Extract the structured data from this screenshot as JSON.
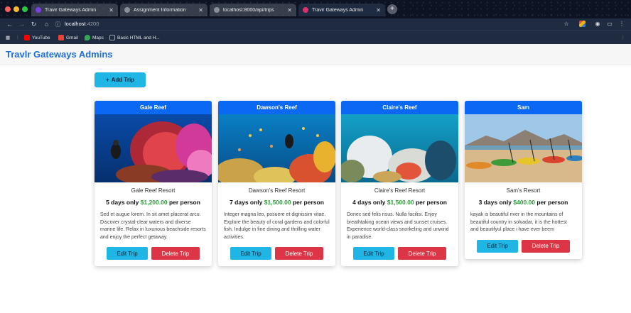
{
  "browser": {
    "tabs": [
      {
        "title": "Travir Gateways Admin",
        "active": false
      },
      {
        "title": "Assignment Information",
        "active": false
      },
      {
        "title": "localhost:8000/api/trips",
        "active": false
      },
      {
        "title": "Travir Gateways Admin",
        "active": true
      }
    ],
    "url_host": "localhost",
    "url_port": ":4200",
    "bookmarks": [
      {
        "label": "YouTube",
        "icon": "youtube-icon",
        "color": "#ff0000"
      },
      {
        "label": "Gmail",
        "icon": "gmail-icon",
        "color": "#ea4335"
      },
      {
        "label": "Maps",
        "icon": "maps-icon",
        "color": "#34a853"
      },
      {
        "label": "Basic HTML and H...",
        "icon": "codecademy-icon",
        "color": "#9aa1ad"
      }
    ]
  },
  "app": {
    "title": "Travlr Gateways Admins",
    "add_trip_icon": "+",
    "add_trip_label": "Add Trip"
  },
  "trips": [
    {
      "name": "Gale Reef",
      "resort": "Gale Reef Resort",
      "price_prefix": "5 days only ",
      "price": "$1,200.00",
      "price_suffix": " per person",
      "description": "Sed et augue lorem. In sit amet placerat arcu. Discover crystal-clear waters and diverse marine life. Relax in luxurious beachside resorts and enjoy the perfect getaway.",
      "edit_label": "Edit Trip",
      "delete_label": "Delete Trip",
      "image": "reef-fan-photo"
    },
    {
      "name": "Dawson's Reef",
      "resort": "Dawson's Reef Resort",
      "price_prefix": "7 days only ",
      "price": "$1,500.00",
      "price_suffix": " per person",
      "description": "Integer magna leo, posuere et dignissim vitae. Explore the beauty of coral gardens and colorful fish. Indulge in fine dining and thrilling water activities.",
      "edit_label": "Edit Trip",
      "delete_label": "Delete Trip",
      "image": "coral-fish-photo"
    },
    {
      "name": "Claire's Reef",
      "resort": "Claire's Reef Resort",
      "price_prefix": "4 days only ",
      "price": "$1,500.00",
      "price_suffix": " per person",
      "description": "Donec sed felis risus. Nulla facilisi. Enjoy breathtaking ocean views and sunset cruises. Experience world-class snorkeling and unwind in paradise.",
      "edit_label": "Edit Trip",
      "delete_label": "Delete Trip",
      "image": "coral-garden-photo"
    },
    {
      "name": "Sam",
      "resort": "Sam's Resort",
      "price_prefix": "3 days only ",
      "price": "$400.00",
      "price_suffix": " per person",
      "description": "kayak is beautiful river in the mountains of beautiful country in solvadar, it is the hottest and beautifyul place i have ever beem",
      "edit_label": "Edit Trip",
      "delete_label": "Delete Trip",
      "image": "kayak-beach-photo"
    }
  ],
  "colors": {
    "brand": "#1f6fd6",
    "card_header": "#0a68f2",
    "edit": "#1fb6e6",
    "delete": "#dc3545",
    "price": "#2e9e3b"
  }
}
